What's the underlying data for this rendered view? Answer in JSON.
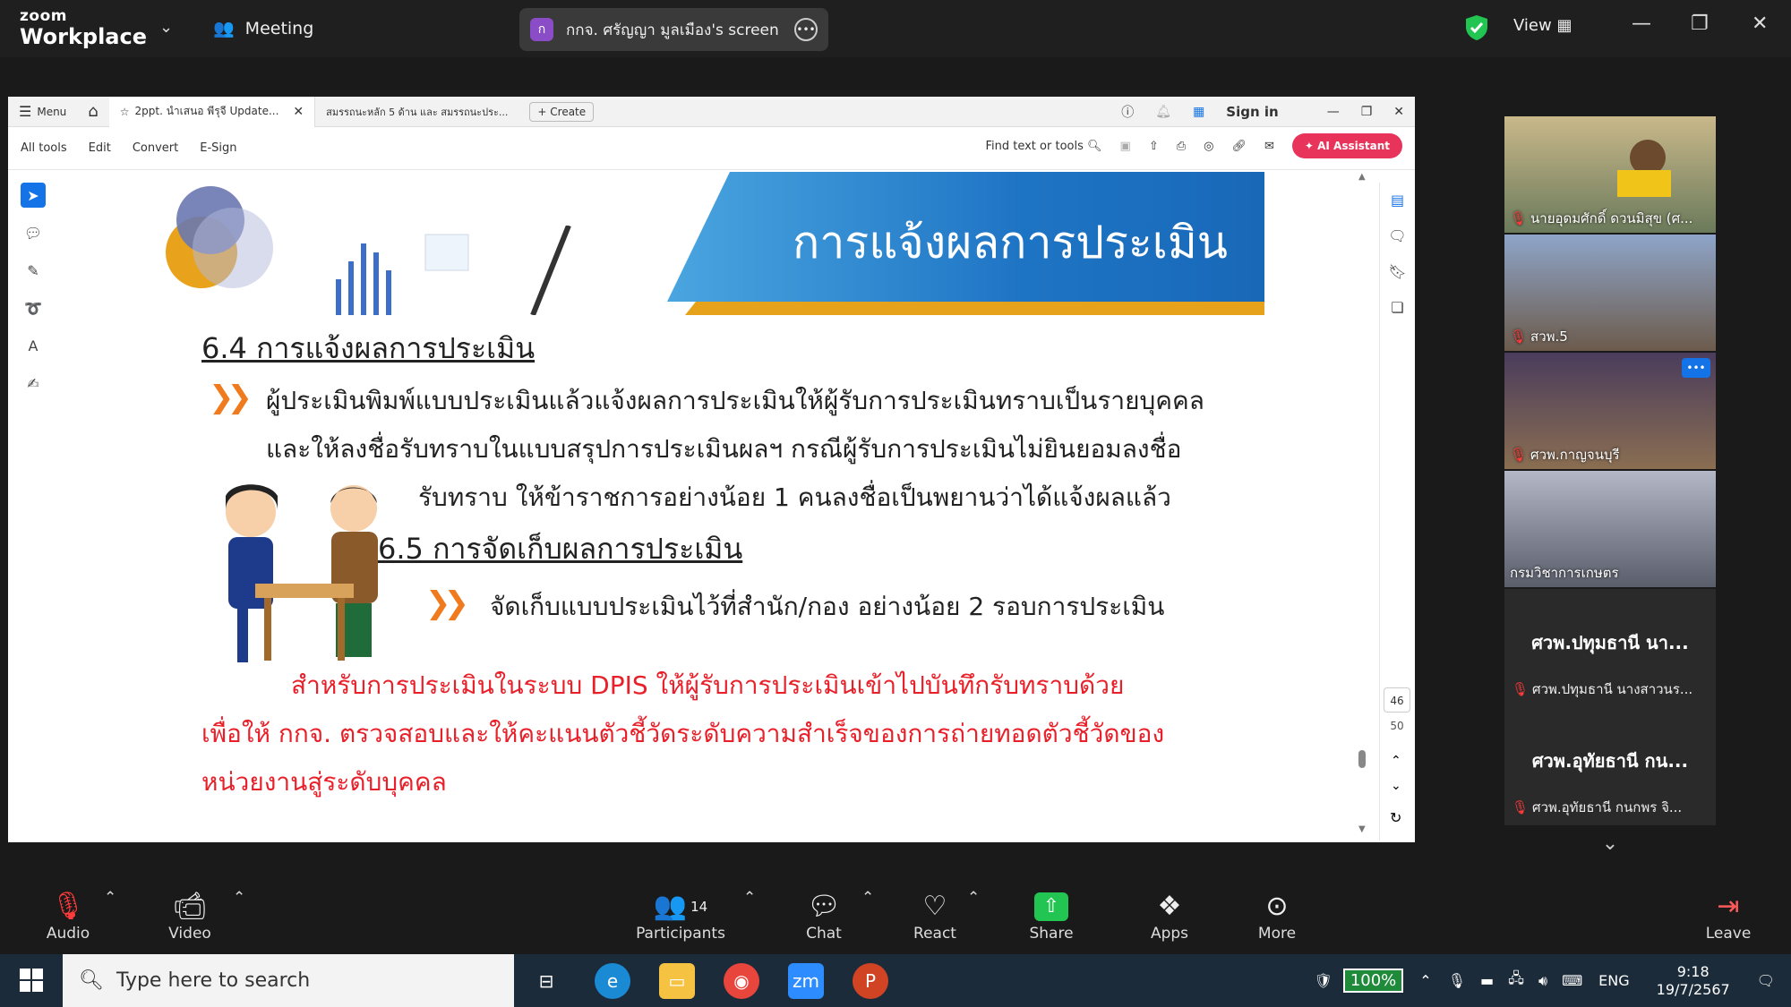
{
  "zoom_top": {
    "logo_line1": "zoom",
    "logo_line2": "Workplace",
    "meeting_label": "Meeting",
    "share_pill_initial": "ก",
    "share_pill_label": "กกจ. ศรัญญา มูลเมือง's screen",
    "view_label": "View"
  },
  "acrobat": {
    "menu_label": "Menu",
    "tab1": "2ppt. นำเสนอ พีรุจี Update...",
    "tab2": "สมรรถนะหลัก 5 ด้าน และ สมรรถนะประ...",
    "create_label": "Create",
    "sign_in": "Sign in",
    "tools": [
      "All tools",
      "Edit",
      "Convert",
      "E-Sign"
    ],
    "find_label": "Find text or tools",
    "ai_label": "AI Assistant",
    "page_current": "46",
    "page_total": "50"
  },
  "slide": {
    "title": "การแจ้งผลการประเมิน",
    "sec1": "6.4 การแจ้งผลการประเมิน",
    "p1": "ผู้ประเมินพิมพ์แบบประเมินแล้วแจ้งผลการประเมินให้ผู้รับการประเมินทราบเป็นรายบุคคล",
    "p2": "และให้ลงชื่อรับทราบในแบบสรุปการประเมินผลฯ กรณีผู้รับการประเมินไม่ยินยอมลงชื่อ",
    "p3": "รับทราบ ให้ข้าราชการอย่างน้อย 1 คนลงชื่อเป็นพยานว่าได้แจ้งผลแล้ว",
    "sec2": "6.5 การจัดเก็บผลการประเมิน",
    "p4": "จัดเก็บแบบประเมินไว้ที่สำนัก/กอง อย่างน้อย 2 รอบการประเมิน",
    "r1": "สำหรับการประเมินในระบบ DPIS ให้ผู้รับการประเมินเข้าไปบันทึกรับทราบด้วย",
    "r2": "เพื่อให้ กกจ. ตรวจสอบและให้คะแนนตัวชี้วัดระดับความสำเร็จของการถ่ายทอดตัวชี้วัดของ",
    "r3": "หน่วยงานสู่ระดับบุคคล"
  },
  "gallery": {
    "tiles": [
      "นายอุดมศักดิ์ ดวนมิสุข (ศ...",
      "สวพ.5",
      "ศวพ.กาญจนบุรี",
      "กรมวิชาการเกษตร"
    ],
    "dark1_big": "ศวพ.ปทุมธานี นา...",
    "dark1_small": "ศวพ.ปทุมธานี นางสาวนร...",
    "dark2_big": "ศวพ.อุทัยธานี กน...",
    "dark2_small": "ศวพ.อุทัยธานี กนกพร จิ..."
  },
  "zoom_bottom": {
    "audio": "Audio",
    "video": "Video",
    "participants": "Participants",
    "participants_count": "14",
    "chat": "Chat",
    "react": "React",
    "share": "Share",
    "apps": "Apps",
    "more": "More",
    "leave": "Leave"
  },
  "taskbar": {
    "search_placeholder": "Type here to search",
    "battery": "100%",
    "lang": "ENG",
    "time": "9:18",
    "date": "19/7/2567"
  }
}
